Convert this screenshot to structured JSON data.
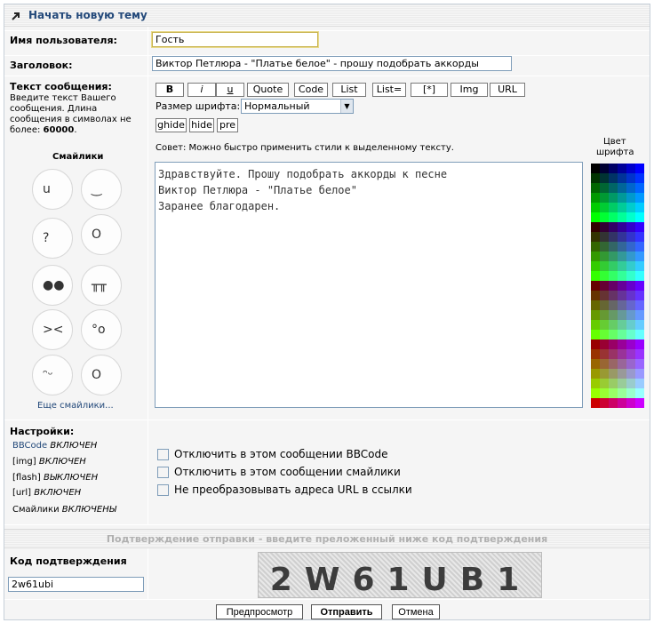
{
  "header": {
    "title": "Начать новую тему"
  },
  "form": {
    "username_label": "Имя пользователя:",
    "username_value": "Гость",
    "subject_label": "Заголовок:",
    "subject_value": "Виктор Петлюра - \"Платье белое\" - прошу подобрать аккорды",
    "message_label": "Текст сообщения:",
    "message_hint": "Введите текст Вашего сообщения. Длина сообщения в символах не более:",
    "message_limit": "60000",
    "message_hint_end": ".",
    "smilies_title": "Смайлики",
    "more_smilies": "Еще смайлики...",
    "font_size_label": "Размер шрифта:",
    "font_size_value": "Нормальный",
    "tip": "Совет: Можно быстро применить стили к выделенному тексту.",
    "font_color_label_1": "Цвет",
    "font_color_label_2": "шрифта",
    "message_line_1": "Здравствуйте. Прошу подобрать аккорды к песне",
    "message_line_2": "Виктор Петлюра - \"Платье белое\"",
    "message_line_3": "Заранее благодарен."
  },
  "toolbar": {
    "b": "B",
    "i": "i",
    "u": "u",
    "quote": "Quote",
    "code": "Code",
    "list": "List",
    "list_eq": "List=",
    "star": "[*]",
    "img": "Img",
    "url": "URL",
    "ghide": "ghide",
    "hide": "hide",
    "pre": "pre"
  },
  "settings": {
    "label": "Настройки:",
    "bbcode_link": "BBCode",
    "bbcode_state": "ВКЛЮЧЕН",
    "img_tag": "[img]",
    "img_state": "ВКЛЮЧЕН",
    "flash_tag": "[flash]",
    "flash_state": "ВЫКЛЮЧЕН",
    "url_tag": "[url]",
    "url_state": "ВКЛЮЧЕН",
    "smilies_word": "Смайлики",
    "smilies_state": "ВКЛЮЧЕНЫ",
    "opt_disable_bbcode": "Отключить в этом сообщении BBCode",
    "opt_disable_smilies": "Отключить в этом сообщении смайлики",
    "opt_no_urls": "Не преобразовывать адреса URL в ссылки"
  },
  "confirm": {
    "bar_text": "Подтверждение отправки - введите преложенный ниже код подтверждения",
    "code_label": "Код подтверждения",
    "code_value": "2w61ubi",
    "captcha_text": "2W61UB1"
  },
  "actions": {
    "preview": "Предпросмотр",
    "submit": "Отправить",
    "cancel": "Отмена"
  },
  "colors": {
    "link": "#23497a",
    "border": "#7f9db9"
  }
}
